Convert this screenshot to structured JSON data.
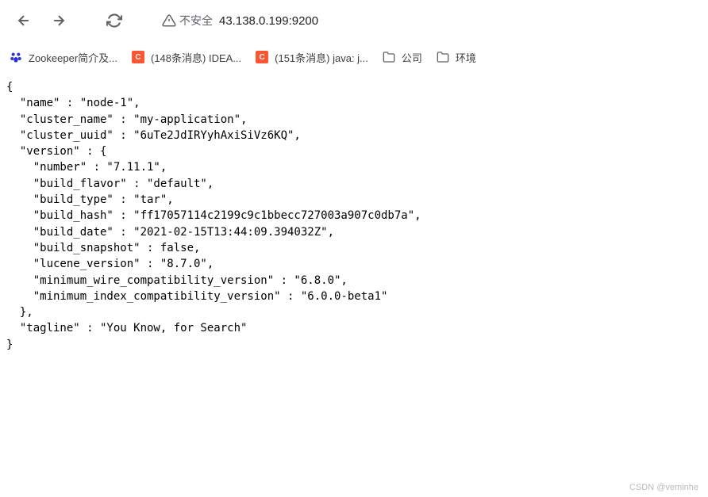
{
  "toolbar": {
    "security_label": "不安全",
    "url": "43.138.0.199:9200"
  },
  "bookmarks": [
    {
      "icon": "baidu",
      "label": "Zookeeper简介及..."
    },
    {
      "icon": "csdn",
      "label": "(148条消息) IDEA..."
    },
    {
      "icon": "csdn",
      "label": "(151条消息) java: j..."
    },
    {
      "icon": "folder",
      "label": "公司"
    },
    {
      "icon": "folder",
      "label": "环境"
    }
  ],
  "response": {
    "name": "node-1",
    "cluster_name": "my-application",
    "cluster_uuid": "6uTe2JdIRYyhAxiSiVz6KQ",
    "version": {
      "number": "7.11.1",
      "build_flavor": "default",
      "build_type": "tar",
      "build_hash": "ff17057114c2199c9c1bbecc727003a907c0db7a",
      "build_date": "2021-02-15T13:44:09.394032Z",
      "build_snapshot": "false",
      "lucene_version": "8.7.0",
      "minimum_wire_compatibility_version": "6.8.0",
      "minimum_index_compatibility_version": "6.0.0-beta1"
    },
    "tagline": "You Know, for Search"
  },
  "watermark": "CSDN @veminhe"
}
